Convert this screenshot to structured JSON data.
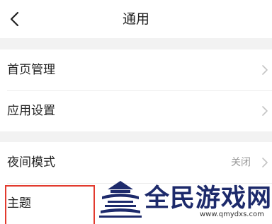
{
  "header": {
    "title": "通用"
  },
  "settings_groups": [
    {
      "items": [
        {
          "label": "首页管理",
          "value": ""
        },
        {
          "label": "应用设置",
          "value": ""
        }
      ]
    },
    {
      "items": [
        {
          "label": "夜间模式",
          "value": "关闭"
        },
        {
          "label": "主题",
          "value": ""
        }
      ]
    }
  ],
  "watermark": {
    "title": "全民游戏网",
    "url": "www.qmydxs.com"
  },
  "colors": {
    "background": "#f2f2f2",
    "card": "#ffffff",
    "text": "#222222",
    "secondary_text": "#999999",
    "highlight": "#e23a2e",
    "watermark_text": "#1d2a6b"
  },
  "icons": {
    "back": "chevron-left-icon",
    "row_arrow": "chevron-right-icon"
  }
}
